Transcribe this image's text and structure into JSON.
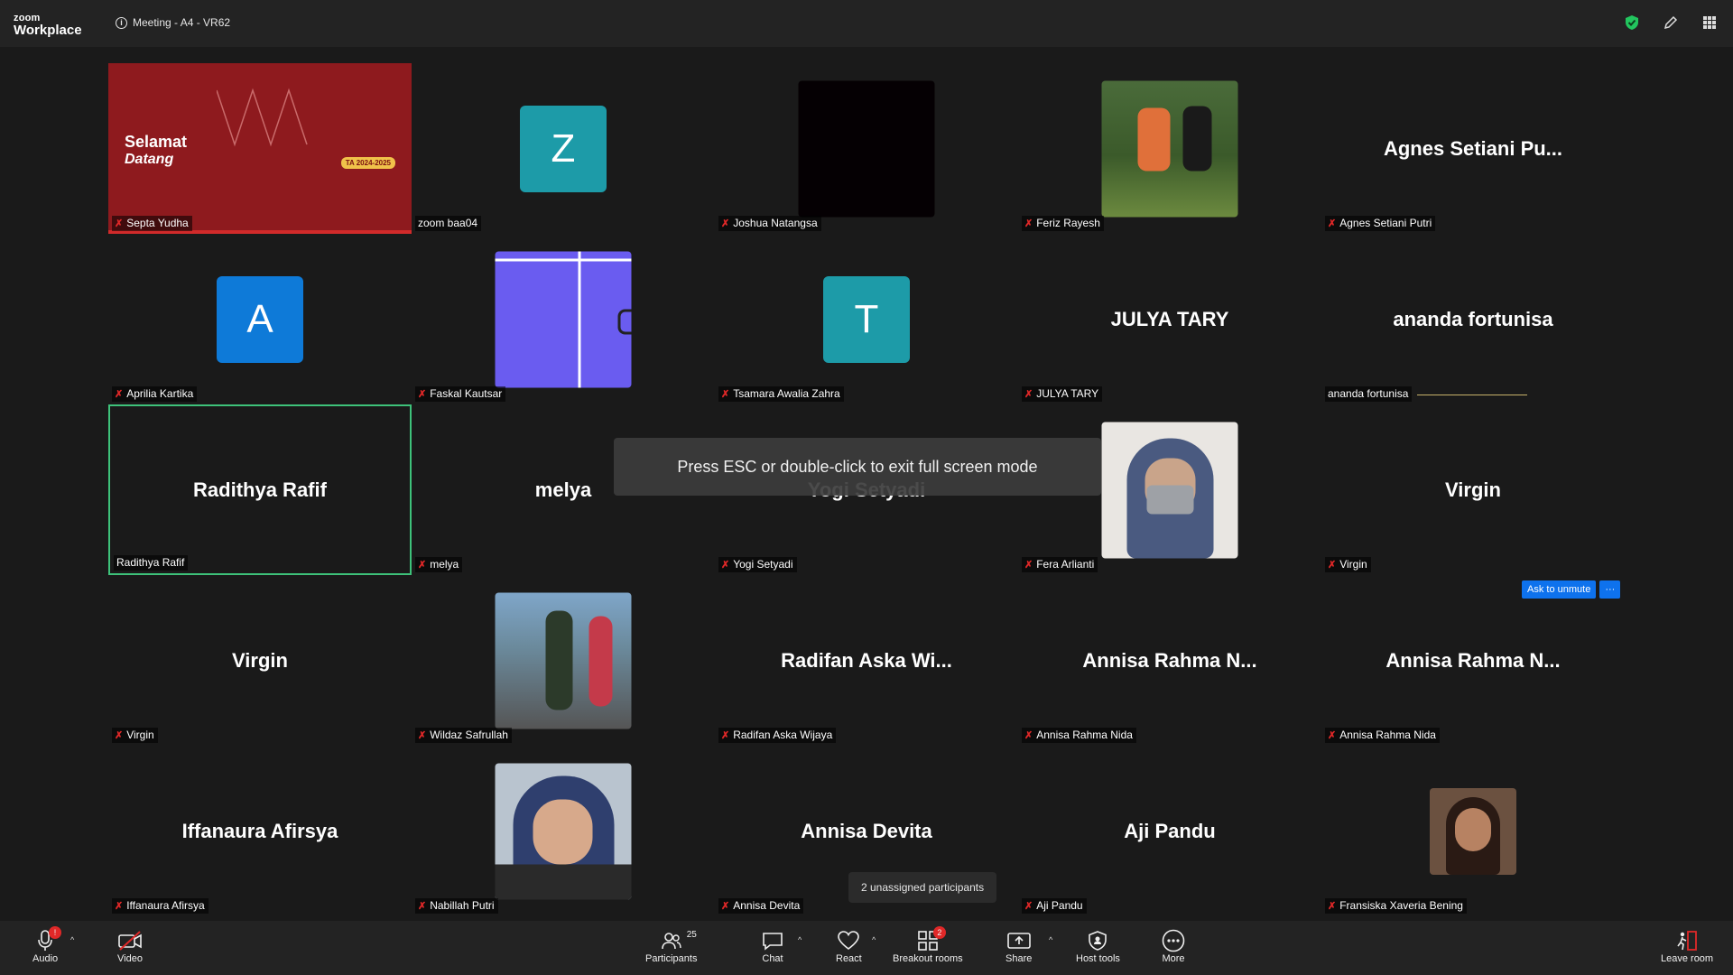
{
  "app": {
    "logo_top": "zoom",
    "logo_bottom": "Workplace",
    "meeting_title": "Meeting - A4 - VR62"
  },
  "tiles": [
    {
      "name": "Septa Yudha",
      "display": "",
      "kind": "share",
      "slide_title": "Selamat",
      "slide_sub": "Datang",
      "slide_badge": "TA 2024-2025"
    },
    {
      "name": "zoom baa04",
      "display": "",
      "kind": "avatar",
      "letter": "Z",
      "color": "#1d9ba8",
      "muted": false
    },
    {
      "name": "Joshua Natangsa",
      "display": "",
      "kind": "black"
    },
    {
      "name": "Feriz Rayesh",
      "display": "",
      "kind": "photo",
      "color": "#5b7a3a"
    },
    {
      "name": "Agnes Setiani Putri",
      "display": "Agnes Setiani Pu...",
      "kind": "text"
    },
    {
      "name": "Aprilia Kartika",
      "display": "",
      "kind": "avatar",
      "letter": "A",
      "color": "#0e7ad8"
    },
    {
      "name": "Faskal Kautsar",
      "display": "",
      "kind": "photo",
      "color": "#6a5cf0"
    },
    {
      "name": "Tsamara Awalia Zahra",
      "display": "",
      "kind": "avatar",
      "letter": "T",
      "color": "#1d9ba8"
    },
    {
      "name": "JULYA TARY",
      "display": "JULYA TARY",
      "kind": "text"
    },
    {
      "name": "ananda fortunisa",
      "display": "ananda fortunisa",
      "kind": "text",
      "muted": false
    },
    {
      "name": "Radithya Rafif",
      "display": "Radithya Rafif",
      "kind": "text",
      "muted": false,
      "active": true
    },
    {
      "name": "melya",
      "display": "melya",
      "kind": "text"
    },
    {
      "name": "Yogi Setyadi",
      "display": "Yogi Setyadi",
      "kind": "text"
    },
    {
      "name": "Fera Arlianti",
      "display": "",
      "kind": "photo",
      "color": "#8a8f9c"
    },
    {
      "name": "Virgin",
      "display": "Virgin",
      "kind": "text"
    },
    {
      "name": "Virgin",
      "display": "Virgin",
      "kind": "text"
    },
    {
      "name": "Wildaz Safrullah",
      "display": "",
      "kind": "photo",
      "color": "#4f6a86"
    },
    {
      "name": "Radifan Aska Wijaya",
      "display": "Radifan Aska Wi...",
      "kind": "text"
    },
    {
      "name": "Annisa Rahma Nida",
      "display": "Annisa Rahma N...",
      "kind": "text"
    },
    {
      "name": "Annisa Rahma Nida",
      "display": "Annisa Rahma N...",
      "kind": "text"
    },
    {
      "name": "Iffanaura Afirsya",
      "display": "Iffanaura Afirsya",
      "kind": "text"
    },
    {
      "name": "Nabillah Putri",
      "display": "",
      "kind": "photo",
      "color": "#3d4e73"
    },
    {
      "name": "Annisa Devita",
      "display": "Annisa Devita",
      "kind": "text"
    },
    {
      "name": "Aji Pandu",
      "display": "Aji Pandu",
      "kind": "text"
    },
    {
      "name": "Fransiska Xaveria Bening",
      "display": "",
      "kind": "photo-small",
      "color": "#6b5140"
    }
  ],
  "overlays": {
    "fullscreen_toast": "Press ESC or double-click to exit full screen mode",
    "unassigned": "2 unassigned participants",
    "ask_unmute": "Ask to unmute",
    "more_dots": "···"
  },
  "toolbar": {
    "audio": "Audio",
    "audio_badge": "!",
    "video": "Video",
    "participants": "Participants",
    "participants_count": "25",
    "chat": "Chat",
    "react": "React",
    "breakout": "Breakout rooms",
    "breakout_badge": "2",
    "share": "Share",
    "host_tools": "Host tools",
    "more": "More",
    "leave": "Leave room"
  },
  "colors": {
    "mute": "#e02828",
    "accent": "#0e72ed",
    "active_border": "#3ec27a",
    "shield": "#22c55e"
  }
}
